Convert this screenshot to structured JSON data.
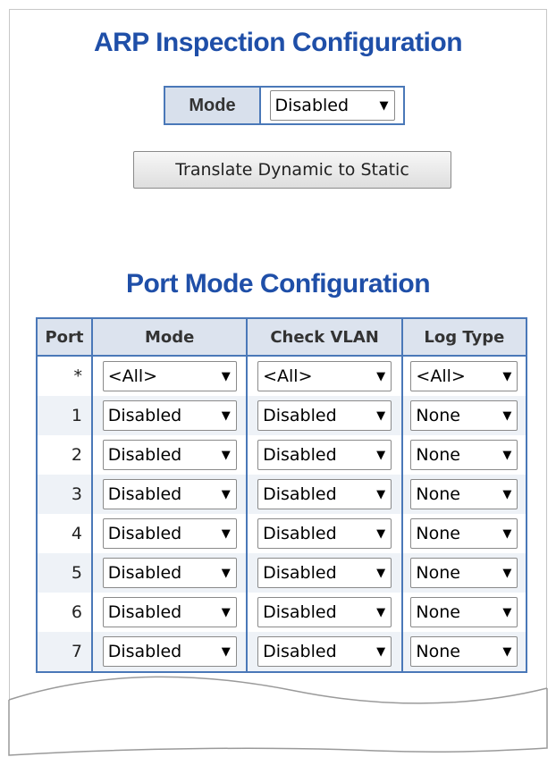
{
  "page": {
    "title": "ARP Inspection Configuration",
    "mode_label": "Mode",
    "mode_value": "Disabled",
    "translate_button": "Translate Dynamic to Static",
    "port_section_title": "Port Mode Configuration"
  },
  "table": {
    "headers": [
      "Port",
      "Mode",
      "Check VLAN",
      "Log Type"
    ],
    "rows": [
      {
        "port": "*",
        "mode": "<All>",
        "check_vlan": "<All>",
        "log_type": "<All>"
      },
      {
        "port": "1",
        "mode": "Disabled",
        "check_vlan": "Disabled",
        "log_type": "None"
      },
      {
        "port": "2",
        "mode": "Disabled",
        "check_vlan": "Disabled",
        "log_type": "None"
      },
      {
        "port": "3",
        "mode": "Disabled",
        "check_vlan": "Disabled",
        "log_type": "None"
      },
      {
        "port": "4",
        "mode": "Disabled",
        "check_vlan": "Disabled",
        "log_type": "None"
      },
      {
        "port": "5",
        "mode": "Disabled",
        "check_vlan": "Disabled",
        "log_type": "None"
      },
      {
        "port": "6",
        "mode": "Disabled",
        "check_vlan": "Disabled",
        "log_type": "None"
      },
      {
        "port": "7",
        "mode": "Disabled",
        "check_vlan": "Disabled",
        "log_type": "None"
      }
    ]
  },
  "icons": {
    "dropdown": "chevron-down-icon"
  },
  "colors": {
    "title": "#1f4fa8",
    "border": "#4a78b8",
    "header_bg": "#dce3ee"
  }
}
